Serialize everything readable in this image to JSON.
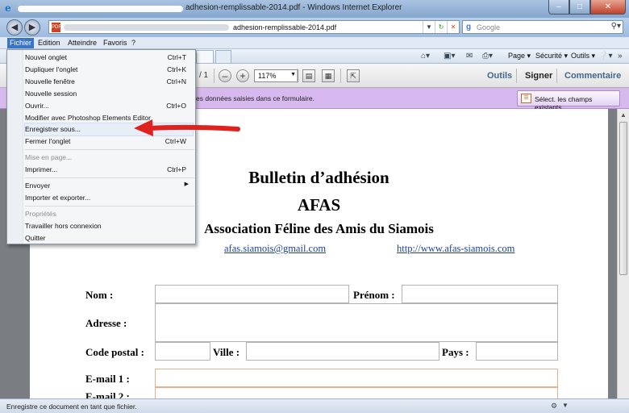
{
  "window": {
    "title": "adhesion-remplissable-2014.pdf - Windows Internet Explorer",
    "colors": {
      "accent": "#3a74c4",
      "notice": "#d8b9ef",
      "close": "#c2412a"
    }
  },
  "address": {
    "url_tail": "adhesion-remplissable-2014.pdf",
    "search_placeholder": "Google"
  },
  "menubar": {
    "items": [
      "Fichier",
      "Edition",
      "Atteindre",
      "Favoris",
      "?"
    ]
  },
  "commandbar": {
    "page": "Page",
    "security": "Sécurité",
    "tools": "Outils"
  },
  "acrobat": {
    "page_total": "/ 1",
    "zoom": "117%",
    "tabs": [
      "Outils",
      "Signer",
      "Commentaire"
    ]
  },
  "notice": {
    "text": "es données saisies dans ce formulaire.",
    "button": "Sélect. les champs existants"
  },
  "file_menu": {
    "items": [
      {
        "label": "Nouvel onglet",
        "shortcut": "Ctrl+T",
        "disabled": false
      },
      {
        "label": "Dupliquer l'onglet",
        "shortcut": "Ctrl+K",
        "disabled": false
      },
      {
        "label": "Nouvelle fenêtre",
        "shortcut": "Ctrl+N",
        "disabled": false
      },
      {
        "label": "Nouvelle session",
        "shortcut": "",
        "disabled": false
      },
      {
        "label": "Ouvrir...",
        "shortcut": "Ctrl+O",
        "disabled": false
      },
      {
        "label": "Modifier avec Photoshop Elements Editor",
        "shortcut": "",
        "disabled": false
      },
      {
        "label": "Enregistrer sous...",
        "shortcut": "",
        "disabled": false
      },
      {
        "label": "Fermer l'onglet",
        "shortcut": "Ctrl+W",
        "disabled": false
      },
      {
        "label": "Mise en page...",
        "shortcut": "",
        "disabled": true
      },
      {
        "label": "Imprimer...",
        "shortcut": "Ctrl+P",
        "disabled": false
      },
      {
        "label": "Envoyer",
        "shortcut": "",
        "disabled": false
      },
      {
        "label": "Importer et exporter...",
        "shortcut": "",
        "disabled": false
      },
      {
        "label": "Propriétés",
        "shortcut": "",
        "disabled": true
      },
      {
        "label": "Travailler hors connexion",
        "shortcut": "",
        "disabled": false
      },
      {
        "label": "Quitter",
        "shortcut": "",
        "disabled": false
      }
    ]
  },
  "document": {
    "title": "Bulletin d’adhésion",
    "org_short": "AFAS",
    "org_full": "Association Féline des Amis du Siamois",
    "email": "afas.siamois@gmail.com",
    "website": "http://www.afas-siamois.com",
    "fields": {
      "nom": "Nom :",
      "prenom": "Prénom :",
      "adresse": "Adresse :",
      "code_postal": "Code postal :",
      "ville": "Ville :",
      "pays": "Pays :",
      "email1": "E-mail 1 :",
      "email2": "E-mail 2 :"
    }
  },
  "status": {
    "text": "Enregistre ce document en tant que fichier."
  }
}
